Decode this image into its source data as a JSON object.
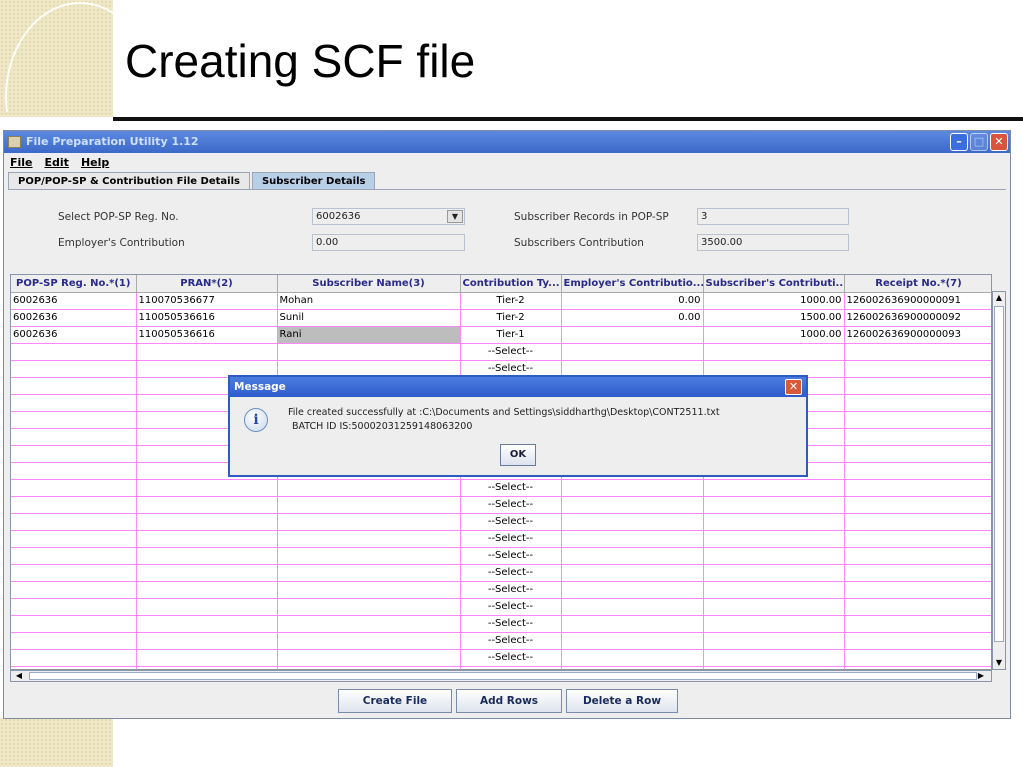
{
  "slide": {
    "title": "Creating SCF file"
  },
  "window": {
    "title": "File Preparation Utility 1.12",
    "controls": {
      "minimize": "–",
      "maximize": "□",
      "close": "✕"
    }
  },
  "menu": {
    "file": "File",
    "edit": "Edit",
    "help": "Help"
  },
  "tabs": [
    {
      "label": "POP/POP-SP & Contribution File Details",
      "active": false
    },
    {
      "label": "Subscriber Details",
      "active": true
    }
  ],
  "form": {
    "reg_no_label": "Select POP-SP Reg. No.",
    "reg_no_value": "6002636",
    "employer_contrib_label": "Employer's Contribution",
    "employer_contrib_value": "0.00",
    "subscriber_records_label": "Subscriber Records in POP-SP",
    "subscriber_records_value": "3",
    "subscribers_contrib_label": "Subscribers Contribution",
    "subscribers_contrib_value": "3500.00"
  },
  "table": {
    "columns": [
      "POP-SP Reg. No.*(1)",
      "PRAN*(2)",
      "Subscriber Name(3)",
      "Contribution Ty...",
      "Employer's Contributio...",
      "Subscriber's Contributi...",
      "Receipt No.*(7)"
    ],
    "rows": [
      [
        "6002636",
        "110070536677",
        "Mohan",
        "Tier-2",
        "0.00",
        "1000.00",
        "126002636900000091"
      ],
      [
        "6002636",
        "110050536616",
        "Sunil",
        "Tier-2",
        "0.00",
        "1500.00",
        "126002636900000092"
      ],
      [
        "6002636",
        "110050536616",
        "Rani",
        "Tier-1",
        "",
        "1000.00",
        "126002636900000093"
      ],
      [
        "",
        "",
        "",
        "--Select--",
        "",
        "",
        ""
      ],
      [
        "",
        "",
        "",
        "--Select--",
        "",
        "",
        ""
      ],
      [
        "",
        "",
        "",
        "",
        "",
        "",
        ""
      ],
      [
        "",
        "",
        "",
        "",
        "",
        "",
        ""
      ],
      [
        "",
        "",
        "",
        "",
        "",
        "",
        ""
      ],
      [
        "",
        "",
        "",
        "",
        "",
        "",
        ""
      ],
      [
        "",
        "",
        "",
        "",
        "",
        "",
        ""
      ],
      [
        "",
        "",
        "",
        "",
        "",
        "",
        ""
      ],
      [
        "",
        "",
        "",
        "--Select--",
        "",
        "",
        ""
      ],
      [
        "",
        "",
        "",
        "--Select--",
        "",
        "",
        ""
      ],
      [
        "",
        "",
        "",
        "--Select--",
        "",
        "",
        ""
      ],
      [
        "",
        "",
        "",
        "--Select--",
        "",
        "",
        ""
      ],
      [
        "",
        "",
        "",
        "--Select--",
        "",
        "",
        ""
      ],
      [
        "",
        "",
        "",
        "--Select--",
        "",
        "",
        ""
      ],
      [
        "",
        "",
        "",
        "--Select--",
        "",
        "",
        ""
      ],
      [
        "",
        "",
        "",
        "--Select--",
        "",
        "",
        ""
      ],
      [
        "",
        "",
        "",
        "--Select--",
        "",
        "",
        ""
      ],
      [
        "",
        "",
        "",
        "--Select--",
        "",
        "",
        ""
      ],
      [
        "",
        "",
        "",
        "--Select--",
        "",
        "",
        ""
      ],
      [
        "",
        "",
        "",
        "",
        "",
        "",
        ""
      ]
    ]
  },
  "buttons": {
    "create_file": "Create File",
    "add_rows": "Add Rows",
    "delete_row": "Delete a Row"
  },
  "dialog": {
    "title": "Message",
    "line1": "File created successfully at :C:\\Documents and Settings\\siddharthg\\Desktop\\CONT2511.txt",
    "line2": "BATCH ID IS:50002031259148063200",
    "ok": "OK",
    "icon": "info-icon"
  },
  "colors": {
    "titlebar": "#3c69c8",
    "grid_line": "#ff88ff",
    "header_text": "#2a2a8a"
  }
}
